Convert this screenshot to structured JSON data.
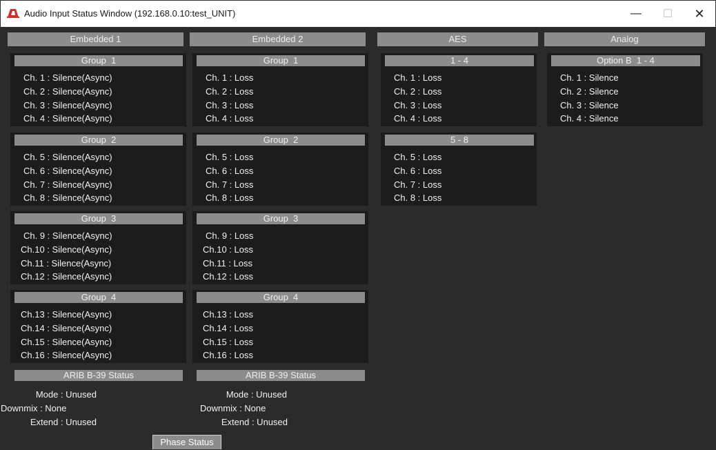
{
  "window": {
    "title": "Audio Input Status Window (192.168.0.10:test_UNIT)",
    "minimize": "—",
    "maximize": "☐",
    "close": "✕"
  },
  "columns": [
    "Embedded 1",
    "Embedded 2",
    "AES",
    "Analog"
  ],
  "embedded1": {
    "groups": [
      {
        "title": "Group  1",
        "lines": [
          "Ch. 1 : Silence(Async)",
          "Ch. 2 : Silence(Async)",
          "Ch. 3 : Silence(Async)",
          "Ch. 4 : Silence(Async)"
        ]
      },
      {
        "title": "Group  2",
        "lines": [
          "Ch. 5 : Silence(Async)",
          "Ch. 6 : Silence(Async)",
          "Ch. 7 : Silence(Async)",
          "Ch. 8 : Silence(Async)"
        ]
      },
      {
        "title": "Group  3",
        "lines": [
          "Ch. 9 : Silence(Async)",
          "Ch.10 : Silence(Async)",
          "Ch.11 : Silence(Async)",
          "Ch.12 : Silence(Async)"
        ]
      },
      {
        "title": "Group  4",
        "lines": [
          "Ch.13 : Silence(Async)",
          "Ch.14 : Silence(Async)",
          "Ch.15 : Silence(Async)",
          "Ch.16 : Silence(Async)"
        ]
      }
    ],
    "arib": {
      "title": "ARIB B-39 Status",
      "lines": [
        "Mode : Unused",
        "Downmix : None",
        "Extend : Unused"
      ]
    }
  },
  "embedded2": {
    "groups": [
      {
        "title": "Group  1",
        "lines": [
          "Ch. 1 : Loss",
          "Ch. 2 : Loss",
          "Ch. 3 : Loss",
          "Ch. 4 : Loss"
        ]
      },
      {
        "title": "Group  2",
        "lines": [
          "Ch. 5 : Loss",
          "Ch. 6 : Loss",
          "Ch. 7 : Loss",
          "Ch. 8 : Loss"
        ]
      },
      {
        "title": "Group  3",
        "lines": [
          "Ch. 9 : Loss",
          "Ch.10 : Loss",
          "Ch.11 : Loss",
          "Ch.12 : Loss"
        ]
      },
      {
        "title": "Group  4",
        "lines": [
          "Ch.13 : Loss",
          "Ch.14 : Loss",
          "Ch.15 : Loss",
          "Ch.16 : Loss"
        ]
      }
    ],
    "arib": {
      "title": "ARIB B-39 Status",
      "lines": [
        "Mode : Unused",
        "Downmix : None",
        "Extend : Unused"
      ]
    }
  },
  "aes": {
    "groups": [
      {
        "title": "1 - 4",
        "lines": [
          "Ch. 1 : Loss",
          "Ch. 2 : Loss",
          "Ch. 3 : Loss",
          "Ch. 4 : Loss"
        ]
      },
      {
        "title": "5 - 8",
        "lines": [
          "Ch. 5 : Loss",
          "Ch. 6 : Loss",
          "Ch. 7 : Loss",
          "Ch. 8 : Loss"
        ]
      }
    ]
  },
  "analog": {
    "groups": [
      {
        "title": "Option B  1 - 4",
        "lines": [
          "Ch. 1 : Silence",
          "Ch. 2 : Silence",
          "Ch. 3 : Silence",
          "Ch. 4 : Silence"
        ]
      }
    ]
  },
  "phase_button": "Phase Status",
  "colors": {
    "background": "#2b2b2b",
    "panel": "#1c1c1c",
    "header": "#8c8c8c",
    "text": "#f2f2f2",
    "icon": "#d32f2f"
  }
}
